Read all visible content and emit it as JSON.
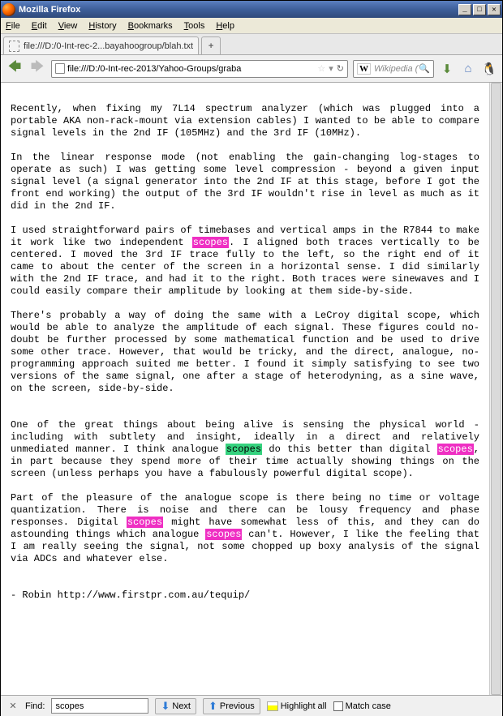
{
  "titlebar": {
    "title": "Mozilla Firefox"
  },
  "menubar": {
    "items": [
      "File",
      "Edit",
      "View",
      "History",
      "Bookmarks",
      "Tools",
      "Help"
    ]
  },
  "tab": {
    "label": "file:///D:/0-Int-rec-2...bayahoogroup/blah.txt"
  },
  "newtab": {
    "glyph": "+"
  },
  "url": {
    "text": "file:///D:/0-Int-rec-2013/Yahoo-Groups/graba"
  },
  "search": {
    "engine": "W",
    "placeholder": "Wikipedia ("
  },
  "findbar": {
    "label": "Find:",
    "value": "scopes",
    "next": "Next",
    "previous": "Previous",
    "highlight": "Highlight all",
    "matchcase": "Match case"
  },
  "body": {
    "p1": "Recently, when fixing my 7L14 spectrum analyzer (which was plugged into a portable AKA non-rack-mount via extension cables) I wanted to be able to compare signal levels in the 2nd IF (105MHz) and the 3rd IF (10MHz).",
    "p2": "In the linear response mode (not enabling the gain-changing log-stages to operate as such) I was getting some level compression - beyond a given input signal level (a signal generator into the 2nd IF at this stage, before I got the front end working) the output of the 3rd IF wouldn't rise in level as much as it did in the 2nd IF.",
    "p3a": "I used straightforward pairs of timebases and vertical amps in the R7844 to make it work like two independent ",
    "hl1": "scopes",
    "p3b": ". I aligned both traces vertically to be centered. I moved the 3rd IF trace fully to the left, so the right end of it came to about the center of the screen in a horizontal sense. I did similarly with the 2nd IF trace, and had it to the right. Both traces were sinewaves and I could easily compare their amplitude by looking at them side-by-side.",
    "p4": "There's probably a way of doing the same with a LeCroy digital scope, which would be able to analyze the amplitude of each signal. These figures could no-doubt be further processed by some mathematical function and be used to drive some other trace. However, that would be tricky, and the direct, analogue, no-programming approach suited me better. I found it simply satisfying to see two versions of the same signal, one after a stage of heterodyning, as a sine wave, on the screen, side-by-side.",
    "p5a": "One of the great things about being alive is sensing the physical world - including with subtlety and insight, ideally in a direct and relatively unmediated manner. I think analogue ",
    "hl2": "scopes",
    "p5b": " do this better than digital ",
    "hl3": "scopes",
    "p5c": ", in part because they spend more of their time actually showing things on the screen (unless perhaps you have a fabulously powerful digital scope).",
    "p6a": "Part of the pleasure of the analogue scope is there being no time or voltage quantization. There is noise and there can be lousy frequency and phase responses. Digital ",
    "hl4": "scopes",
    "p6b": " might have somewhat less of this, and they can do astounding things which analogue ",
    "hl5": "scopes",
    "p6c": " can't. However, I like the feeling that I am really seeing the signal, not some chopped up boxy analysis of the signal via ADCs and whatever else.",
    "sig": "- Robin http://www.firstpr.com.au/tequip/"
  }
}
